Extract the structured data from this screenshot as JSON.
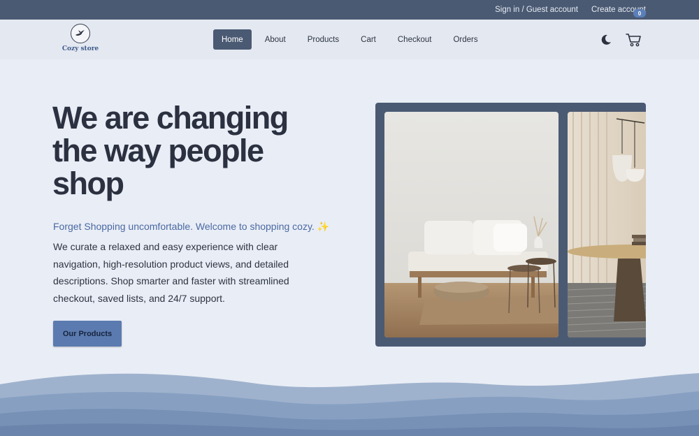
{
  "topbar": {
    "signin_label": "Sign in / Guest account",
    "create_label": "Create account"
  },
  "brand": {
    "name": "Cozy store",
    "logo_icon": "flying-bird-icon"
  },
  "nav": {
    "items": [
      {
        "label": "Home",
        "active": true
      },
      {
        "label": "About",
        "active": false
      },
      {
        "label": "Products",
        "active": false
      },
      {
        "label": "Cart",
        "active": false
      },
      {
        "label": "Checkout",
        "active": false
      },
      {
        "label": "Orders",
        "active": false
      }
    ],
    "theme_icon": "moon-icon",
    "cart_icon": "shopping-cart-icon",
    "cart_count": "0"
  },
  "hero": {
    "title": "We are changing the way people shop",
    "subtitle": "Forget Shopping uncomfortable. Welcome to shopping cozy. ✨",
    "description": "We curate a relaxed and easy experience with clear navigation, high-resolution product views, and detailed descriptions. Shop smarter and faster with streamlined checkout, saved lists, and 24/7 support.",
    "cta_label": "Our Products"
  },
  "colors": {
    "topbar": "#4b5a73",
    "navbar": "#e4e8f0",
    "page_bg": "#e9edf5",
    "accent": "#5b7bb0",
    "title_text": "#2b3140",
    "subtitle_text": "#4a69a3"
  }
}
